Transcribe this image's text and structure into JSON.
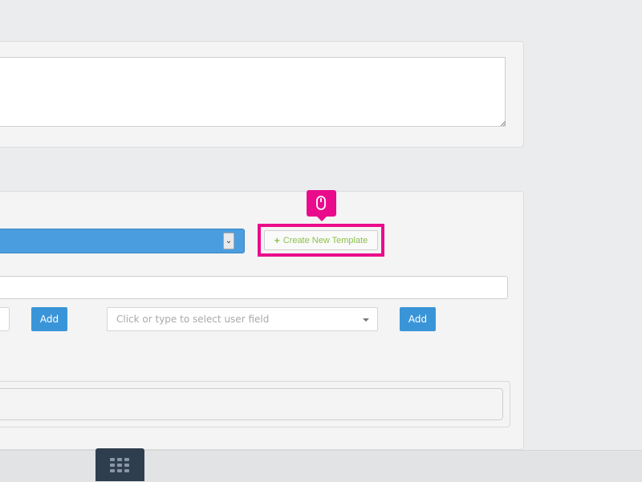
{
  "template_section": {
    "create_button_label": "Create New Template"
  },
  "user_field": {
    "placeholder": "Click or type to select user field"
  },
  "buttons": {
    "add_label_1": "Add",
    "add_label_2": "Add"
  },
  "icons": {
    "create_button_icon": "plus-icon",
    "cursor_badge_icon": "mouse-icon",
    "bottom_tab_icon": "grid-icon",
    "select_caret_icon": "chevron-down-icon"
  },
  "colors": {
    "accent_blue": "#3a95d8",
    "highlight_pink": "#ea0b8c",
    "create_green": "#8cbf4a",
    "dock_dark": "#2f3e4f"
  }
}
